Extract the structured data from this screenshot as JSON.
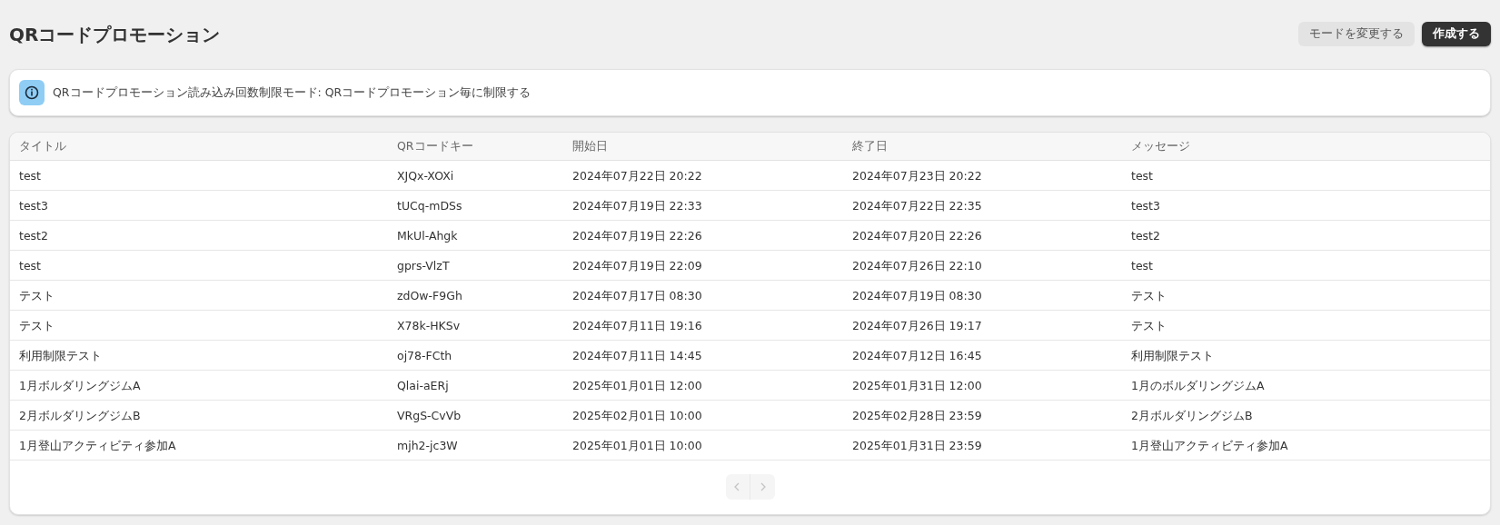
{
  "page": {
    "title": "QRコードプロモーション"
  },
  "actions": [
    {
      "label": "モードを変更する",
      "kind": "secondary"
    },
    {
      "label": "作成する",
      "kind": "primary"
    }
  ],
  "notice": {
    "text": "QRコードプロモーション読み込み回数制限モード: QRコードプロモーション毎に制限する"
  },
  "table": {
    "columns": [
      "タイトル",
      "QRコードキー",
      "開始日",
      "終了日",
      "メッセージ"
    ],
    "rows": [
      [
        "test",
        "XJQx-XOXi",
        "2024年07月22日 20:22",
        "2024年07月23日 20:22",
        "test"
      ],
      [
        "test3",
        "tUCq-mDSs",
        "2024年07月19日 22:33",
        "2024年07月22日 22:35",
        "test3"
      ],
      [
        "test2",
        "MkUl-Ahgk",
        "2024年07月19日 22:26",
        "2024年07月20日 22:26",
        "test2"
      ],
      [
        "test",
        "gprs-VlzT",
        "2024年07月19日 22:09",
        "2024年07月26日 22:10",
        "test"
      ],
      [
        "テスト",
        "zdOw-F9Gh",
        "2024年07月17日 08:30",
        "2024年07月19日 08:30",
        "テスト"
      ],
      [
        "テスト",
        "X78k-HKSv",
        "2024年07月11日 19:16",
        "2024年07月26日 19:17",
        "テスト"
      ],
      [
        "利用制限テスト",
        "oj78-FCth",
        "2024年07月11日 14:45",
        "2024年07月12日 16:45",
        "利用制限テスト"
      ],
      [
        "1月ボルダリングジムA",
        "Qlai-aERj",
        "2025年01月01日 12:00",
        "2025年01月31日 12:00",
        "1月のボルダリングジムA"
      ],
      [
        "2月ボルダリングジムB",
        "VRgS-CvVb",
        "2025年02月01日 10:00",
        "2025年02月28日 23:59",
        "2月ボルダリングジムB"
      ],
      [
        "1月登山アクティビティ参加A",
        "mjh2-jc3W",
        "2025年01月01日 10:00",
        "2025年01月31日 23:59",
        "1月登山アクティビティ参加A"
      ]
    ]
  },
  "pagination": {
    "prev": {
      "disabled": true
    },
    "next": {
      "disabled": true
    }
  }
}
